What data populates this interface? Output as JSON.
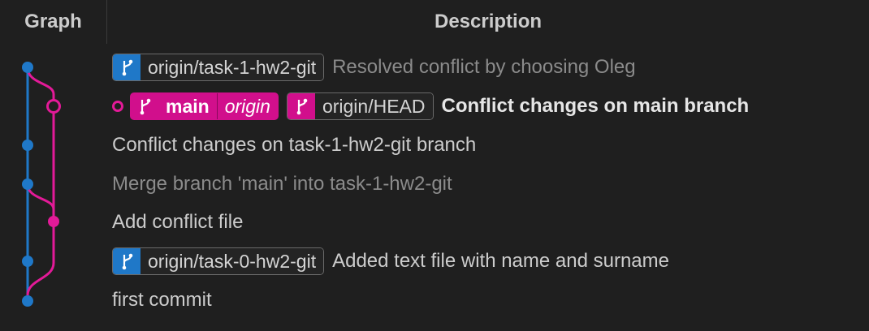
{
  "header": {
    "graph_label": "Graph",
    "description_label": "Description"
  },
  "colors": {
    "blue": "#1f78c8",
    "pink": "#e31a98",
    "text": "#cccccc",
    "dim": "#8b8b8b"
  },
  "rows": [
    {
      "badges": [
        {
          "color": "blue",
          "icon": "branch-icon",
          "label": "origin/task-1-hw2-git"
        }
      ],
      "message": "Resolved conflict by choosing Oleg",
      "style": "dim"
    },
    {
      "current": true,
      "badges": [
        {
          "color": "pink",
          "icon": "branch-icon",
          "label": "main",
          "sub": "origin"
        },
        {
          "color": "pink",
          "icon": "branch-icon",
          "label": "origin/HEAD"
        }
      ],
      "message": "Conflict changes on main branch",
      "style": "bold"
    },
    {
      "badges": [],
      "message": "Conflict changes on task-1-hw2-git branch",
      "style": "normal"
    },
    {
      "badges": [],
      "message": "Merge branch 'main' into task-1-hw2-git",
      "style": "dim"
    },
    {
      "badges": [],
      "message": "Add conflict file",
      "style": "normal"
    },
    {
      "badges": [
        {
          "color": "blue",
          "icon": "branch-icon",
          "label": "origin/task-0-hw2-git"
        }
      ],
      "message": "Added text file with name and surname",
      "style": "normal"
    },
    {
      "badges": [],
      "message": "first commit",
      "style": "normal"
    }
  ]
}
